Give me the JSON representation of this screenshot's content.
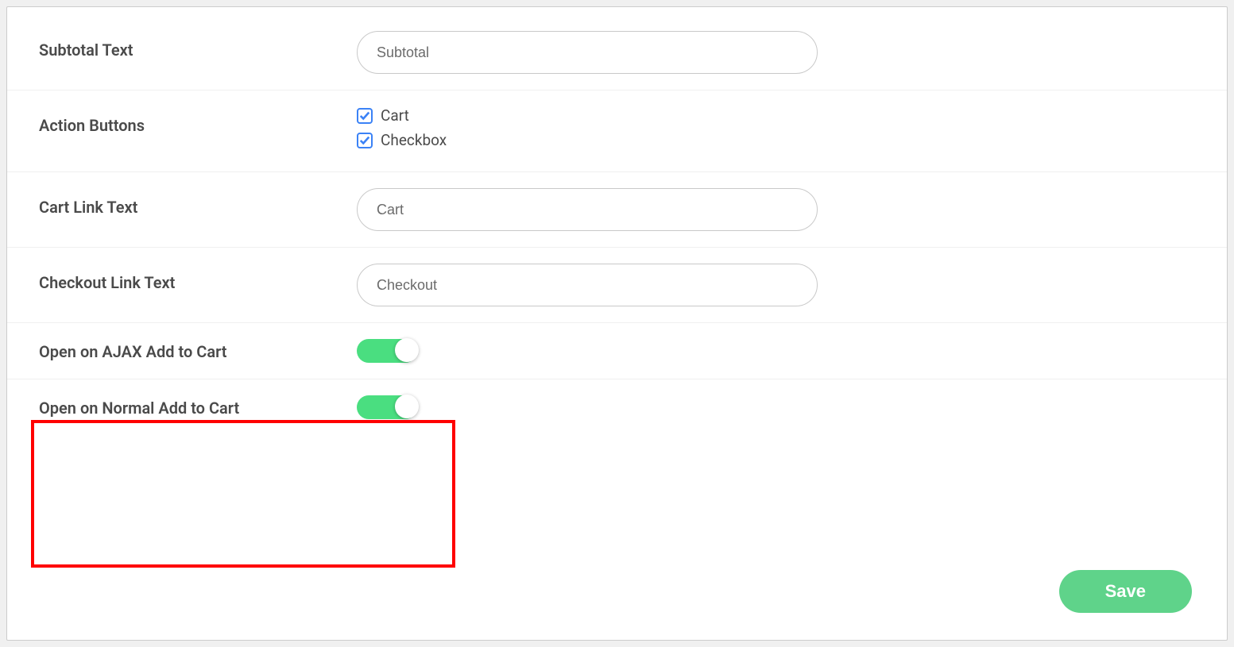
{
  "fields": {
    "subtotal_text": {
      "label": "Subtotal Text",
      "value": "Subtotal"
    },
    "action_buttons": {
      "label": "Action Buttons",
      "options": [
        {
          "label": "Cart",
          "checked": true
        },
        {
          "label": "Checkbox",
          "checked": true
        }
      ]
    },
    "cart_link_text": {
      "label": "Cart Link Text",
      "value": "Cart"
    },
    "checkout_link_text": {
      "label": "Checkout Link Text",
      "value": "Checkout"
    },
    "open_ajax": {
      "label": "Open on AJAX Add to Cart",
      "enabled": true
    },
    "open_normal": {
      "label": "Open on Normal Add to Cart",
      "enabled": true
    }
  },
  "actions": {
    "save_label": "Save"
  }
}
